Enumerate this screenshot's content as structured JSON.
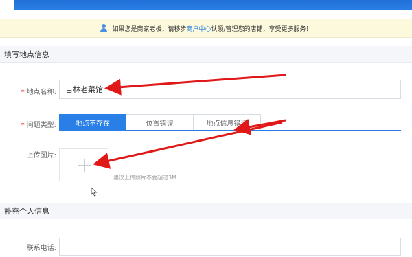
{
  "notice": {
    "prefix": "如果您是商家老板，请移步",
    "link": "商户中心",
    "suffix": "认领/管理您的店铺，享受更多服务！"
  },
  "section1": {
    "title": "填写地点信息"
  },
  "form": {
    "name_label": "地点名称:",
    "name_value": "吉林老菜馆",
    "type_label": "问题类型:",
    "type_tabs": [
      "地点不存在",
      "位置错误",
      "地点信息错误"
    ],
    "upload_label": "上传图片:",
    "upload_hint": "建议上传照片不要超过3M"
  },
  "section2": {
    "title": "补充个人信息"
  },
  "contact": {
    "phone_label": "联系电话:"
  },
  "colors": {
    "accent": "#2a7fe6",
    "required": "#e02020",
    "arrow": "#e01818"
  },
  "icons": [
    "user-icon",
    "plus-icon",
    "mouse-cursor-icon"
  ]
}
